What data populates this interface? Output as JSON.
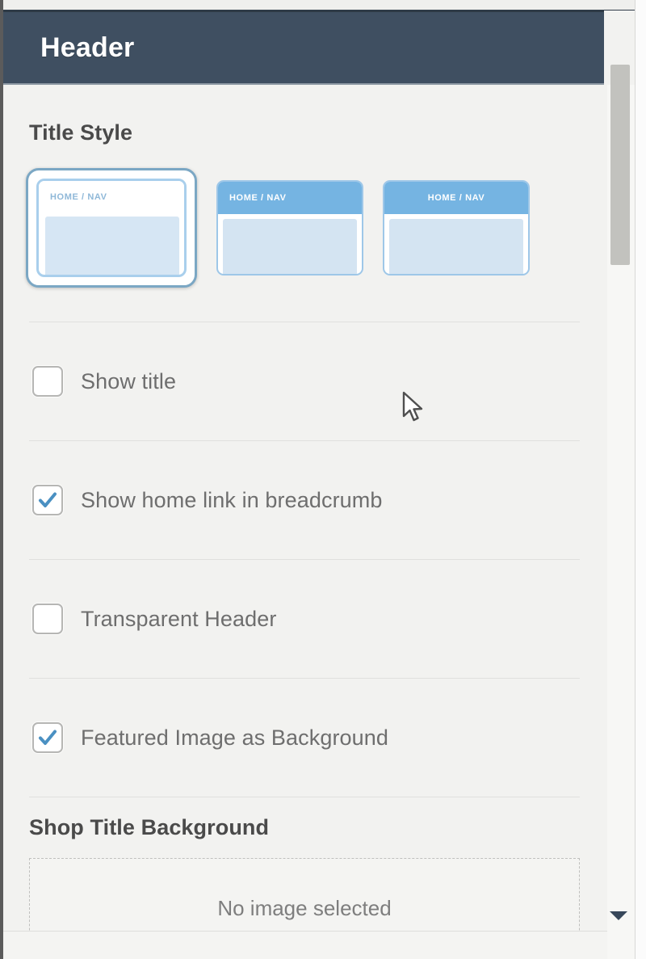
{
  "panel": {
    "header_title": "Header"
  },
  "title_style": {
    "heading": "Title Style",
    "options": [
      {
        "label": "HOME / NAV",
        "variant": "light-bar-left",
        "selected": true
      },
      {
        "label": "HOME / NAV",
        "variant": "blue-bar-left",
        "selected": false
      },
      {
        "label": "HOME / NAV",
        "variant": "blue-bar-center",
        "selected": false
      }
    ]
  },
  "settings": [
    {
      "label": "Show title",
      "checked": false
    },
    {
      "label": "Show home link in breadcrumb",
      "checked": true
    },
    {
      "label": "Transparent Header",
      "checked": false
    },
    {
      "label": "Featured Image as Background",
      "checked": true
    }
  ],
  "shop_title_background": {
    "heading": "Shop Title Background",
    "empty_text": "No image selected"
  },
  "icons": {
    "check": "check-icon",
    "scroll_down": "chevron-down-icon",
    "cursor": "mouse-pointer-icon"
  },
  "colors": {
    "header_bar": "#3f4f61",
    "accent_blue": "#75b4e2",
    "check_blue": "#4a90c2",
    "panel_bg": "#f2f2f0",
    "label_text": "#6e6e6e",
    "heading_text": "#4a4a4a"
  }
}
